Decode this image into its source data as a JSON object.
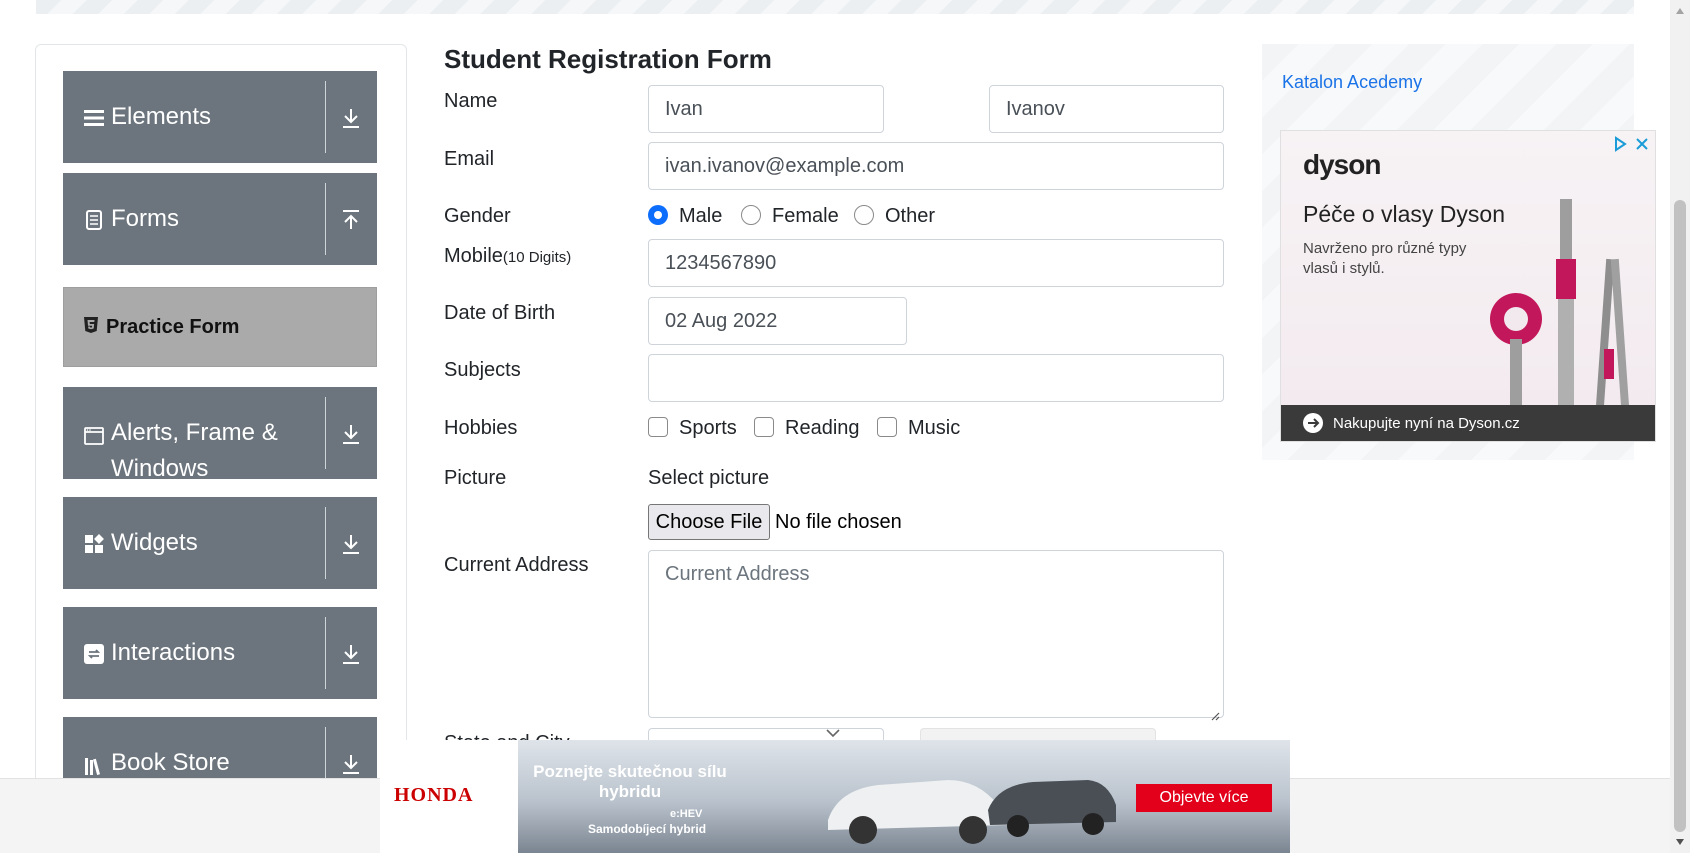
{
  "sidebar": {
    "groups": [
      {
        "label": "Elements",
        "icon": "list-icon",
        "expanded": false
      },
      {
        "label": "Forms",
        "icon": "document-icon",
        "expanded": true
      },
      {
        "label": "Alerts, Frame &",
        "label2": "Windows",
        "icon": "window-icon",
        "expanded": false
      },
      {
        "label": "Widgets",
        "icon": "widgets-icon",
        "expanded": false
      },
      {
        "label": "Interactions",
        "icon": "interactions-icon",
        "expanded": false
      },
      {
        "label": "Book Store",
        "icon": "book-icon",
        "expanded": false
      }
    ],
    "active_item": {
      "label": "Practice Form",
      "icon": "html5-icon"
    }
  },
  "form": {
    "title": "Student Registration Form",
    "name_label": "Name",
    "first_name": "Ivan",
    "last_name": "Ivanov",
    "email_label": "Email",
    "email": "ivan.ivanov@example.com",
    "gender_label": "Gender",
    "gender_options": [
      "Male",
      "Female",
      "Other"
    ],
    "gender_selected": "Male",
    "mobile_label": "Mobile",
    "mobile_hint": "(10 Digits)",
    "mobile": "1234567890",
    "dob_label": "Date of Birth",
    "dob": "02 Aug 2022",
    "subjects_label": "Subjects",
    "subjects": "",
    "hobbies_label": "Hobbies",
    "hobbies": [
      "Sports",
      "Reading",
      "Music"
    ],
    "picture_label": "Picture",
    "select_picture": "Select picture",
    "choose_file": "Choose File",
    "no_file": "No file chosen",
    "address_label": "Current Address",
    "address_placeholder": "Current Address",
    "state_city_label": "State and City"
  },
  "side_ad": {
    "link_text": "Katalon Acedemy",
    "brand": "dyson",
    "headline": "Péče o vlasy Dyson",
    "subtext": "Navrženo pro různé typy vlasů i stylů.",
    "cta": "Nakupujte nyní na Dyson.cz",
    "accent": "#c2185b"
  },
  "footer_ad": {
    "logo": "HONDA",
    "headline": "Poznejte skutečnou sílu hybridu",
    "badge": "e:HEV",
    "subline": "Samodobíjecí hybrid",
    "button": "Objevte více",
    "button_color": "#e2001a"
  },
  "colors": {
    "sidebar_group_bg": "#6c757d",
    "active_item_bg": "#aaaaaa",
    "radio_checked": "#0d6efd"
  }
}
